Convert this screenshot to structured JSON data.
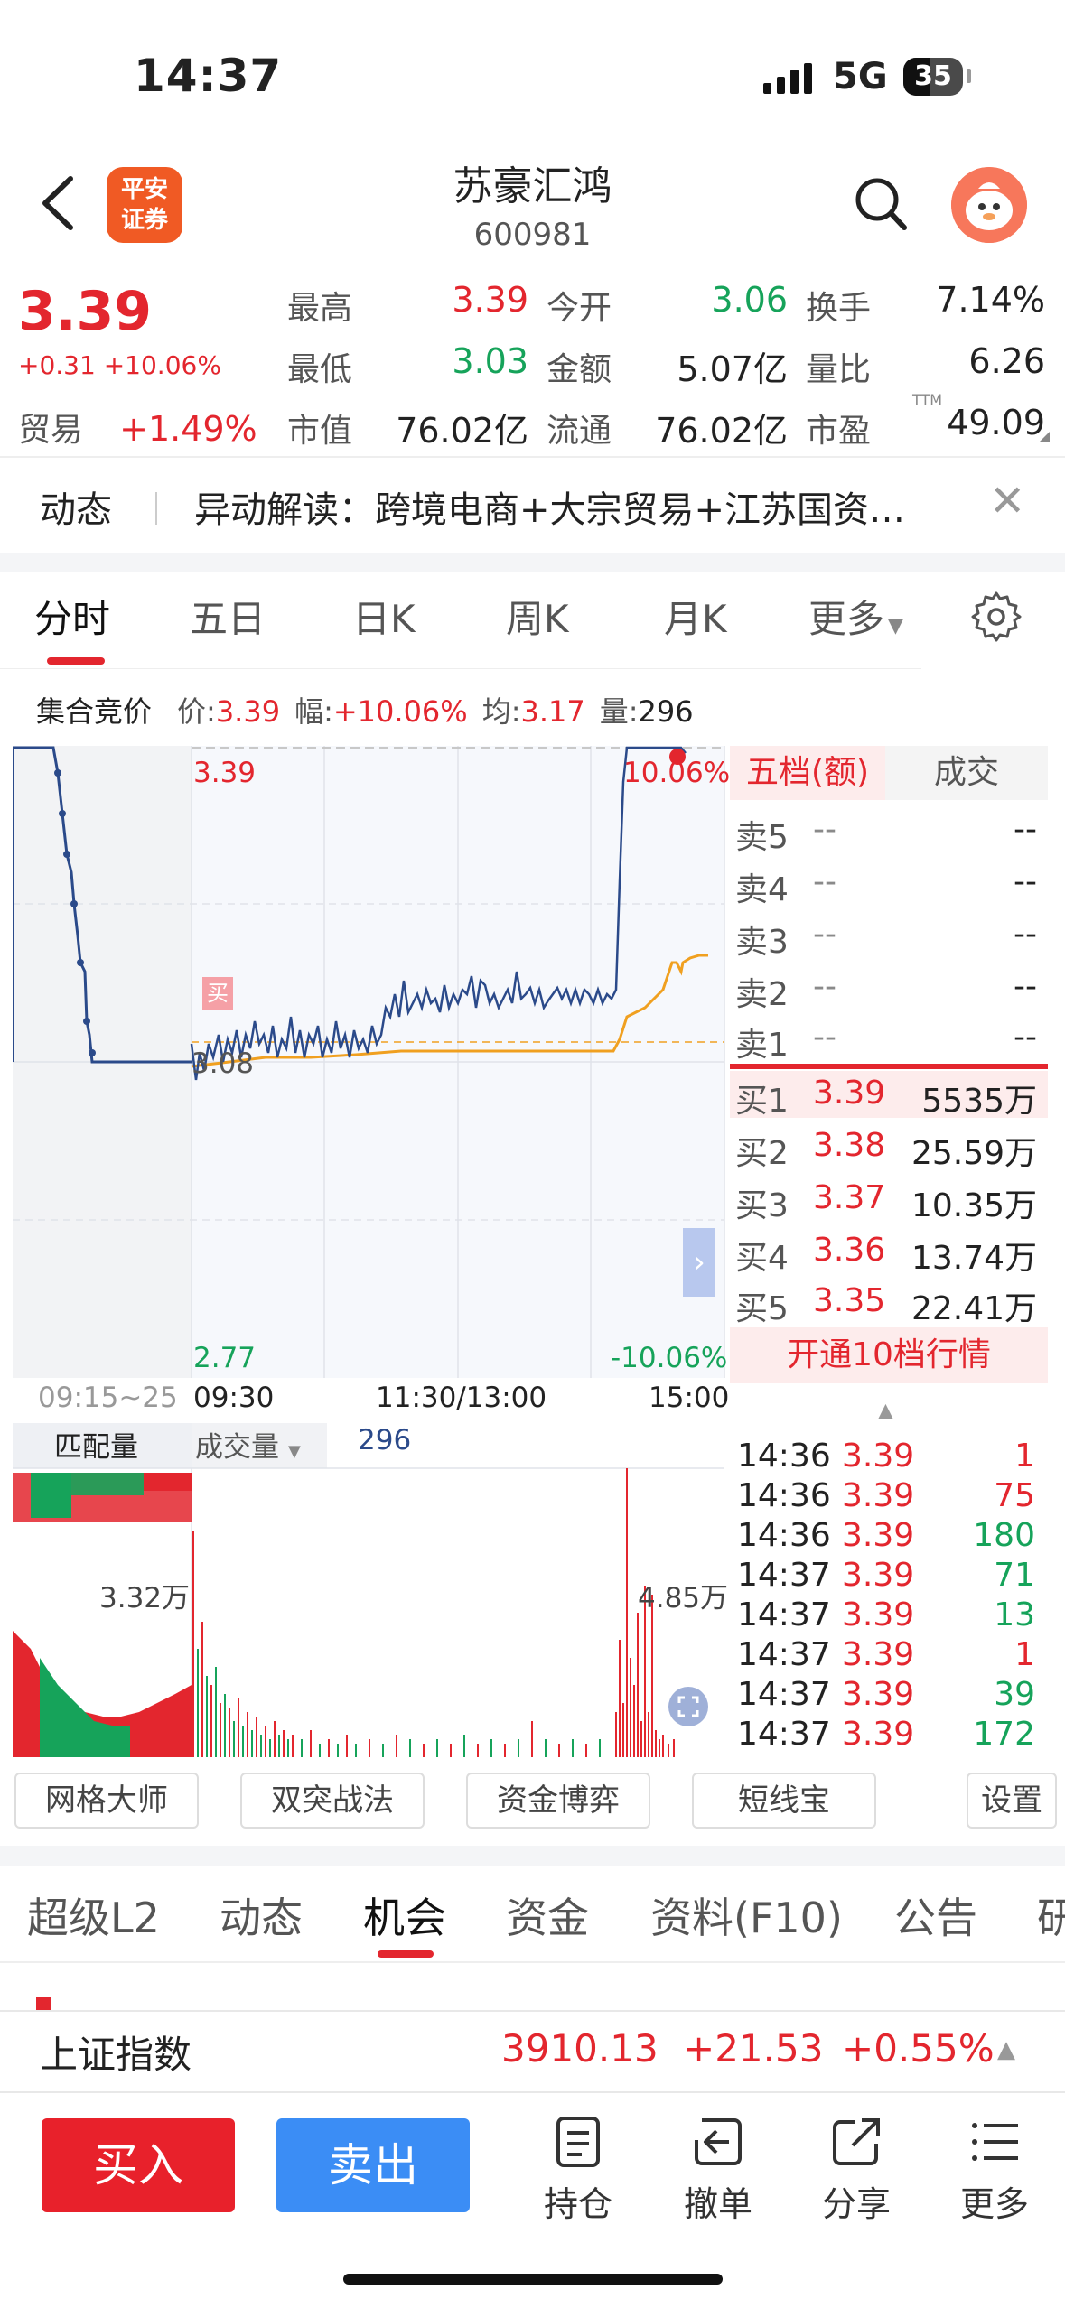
{
  "status": {
    "time": "14:37",
    "network": "5G",
    "battery": "35"
  },
  "header": {
    "broker_logo": "平安\n证券",
    "stock_name": "苏豪汇鸿",
    "stock_code": "600981"
  },
  "quote": {
    "price": "3.39",
    "change": "+0.31 +10.06%",
    "sector_label": "贸易",
    "sector_change": "+1.49%",
    "fields": [
      {
        "label": "最高",
        "value": "3.39"
      },
      {
        "label": "今开",
        "value": "3.06"
      },
      {
        "label": "换手",
        "value": "7.14%"
      },
      {
        "label": "最低",
        "value": "3.03"
      },
      {
        "label": "金额",
        "value": "5.07亿"
      },
      {
        "label": "量比",
        "value": "6.26"
      },
      {
        "label": "市值",
        "value": "76.02亿"
      },
      {
        "label": "流通",
        "value": "76.02亿"
      },
      {
        "label": "市盈",
        "value": "49.09"
      }
    ],
    "pe_suffix": "TTM"
  },
  "news": {
    "tag": "动态",
    "text": "异动解读：跨境电商+大宗贸易+江苏国资…"
  },
  "chart_tabs": [
    "分时",
    "五日",
    "日K",
    "周K",
    "月K",
    "更多"
  ],
  "info_line": {
    "auction": "集合竞价",
    "price_label": "价:",
    "price": "3.39",
    "amp_label": "幅:",
    "amp": "+10.06%",
    "avg_label": "均:",
    "avg": "3.17",
    "vol_label": "量:",
    "vol": "296"
  },
  "chart_labels": {
    "top_price": "3.39",
    "top_pct": "10.06%",
    "bottom_price": "2.77",
    "bottom_pct": "-10.06%",
    "mid_price": "3.08",
    "buy_tag": "买",
    "time_axis": [
      "09:15~25",
      "09:30",
      "11:30/13:00",
      "15:00"
    ],
    "match_vol": "匹配量",
    "vol_type": "成交量",
    "vol_value": "296",
    "vol_left": "3.32万",
    "vol_right": "4.85万"
  },
  "orderbook": {
    "tab1": "五档(额)",
    "tab2": "成交",
    "asks": [
      {
        "label": "卖5",
        "price": "--",
        "vol": "--"
      },
      {
        "label": "卖4",
        "price": "--",
        "vol": "--"
      },
      {
        "label": "卖3",
        "price": "--",
        "vol": "--"
      },
      {
        "label": "卖2",
        "price": "--",
        "vol": "--"
      },
      {
        "label": "卖1",
        "price": "--",
        "vol": "--"
      }
    ],
    "bids": [
      {
        "label": "买1",
        "price": "3.39",
        "vol": "5535万"
      },
      {
        "label": "买2",
        "price": "3.38",
        "vol": "25.59万"
      },
      {
        "label": "买3",
        "price": "3.37",
        "vol": "10.35万"
      },
      {
        "label": "买4",
        "price": "3.36",
        "vol": "13.74万"
      },
      {
        "label": "买5",
        "price": "3.35",
        "vol": "22.41万"
      }
    ],
    "open10": "开通10档行情"
  },
  "ticks": [
    {
      "time": "14:36",
      "price": "3.39",
      "vol": "1",
      "color": "#e3262e"
    },
    {
      "time": "14:36",
      "price": "3.39",
      "vol": "75",
      "color": "#e3262e"
    },
    {
      "time": "14:36",
      "price": "3.39",
      "vol": "180",
      "color": "#16a35a"
    },
    {
      "time": "14:37",
      "price": "3.39",
      "vol": "71",
      "color": "#16a35a"
    },
    {
      "time": "14:37",
      "price": "3.39",
      "vol": "13",
      "color": "#16a35a"
    },
    {
      "time": "14:37",
      "price": "3.39",
      "vol": "1",
      "color": "#e3262e"
    },
    {
      "time": "14:37",
      "price": "3.39",
      "vol": "39",
      "color": "#16a35a"
    },
    {
      "time": "14:37",
      "price": "3.39",
      "vol": "172",
      "color": "#16a35a"
    }
  ],
  "tools": [
    "网格大师",
    "双突战法",
    "资金博弈",
    "短线宝",
    "设置"
  ],
  "bottom_tabs": [
    "超级L2",
    "动态",
    "机会",
    "资金",
    "资料(F10)",
    "公告",
    "研"
  ],
  "index": {
    "name": "上证指数",
    "value": "3910.13",
    "change": "+21.53",
    "pct": "+0.55%"
  },
  "actions": {
    "buy": "买入",
    "sell": "卖出",
    "hold": "持仓",
    "cancel": "撤单",
    "share": "分享",
    "more": "更多"
  },
  "colors": {
    "up": "#e3262e",
    "down": "#16a35a",
    "price_line": "#2b4a8a",
    "avg_line": "#f0a020",
    "sell_btn": "#3b8df5"
  }
}
